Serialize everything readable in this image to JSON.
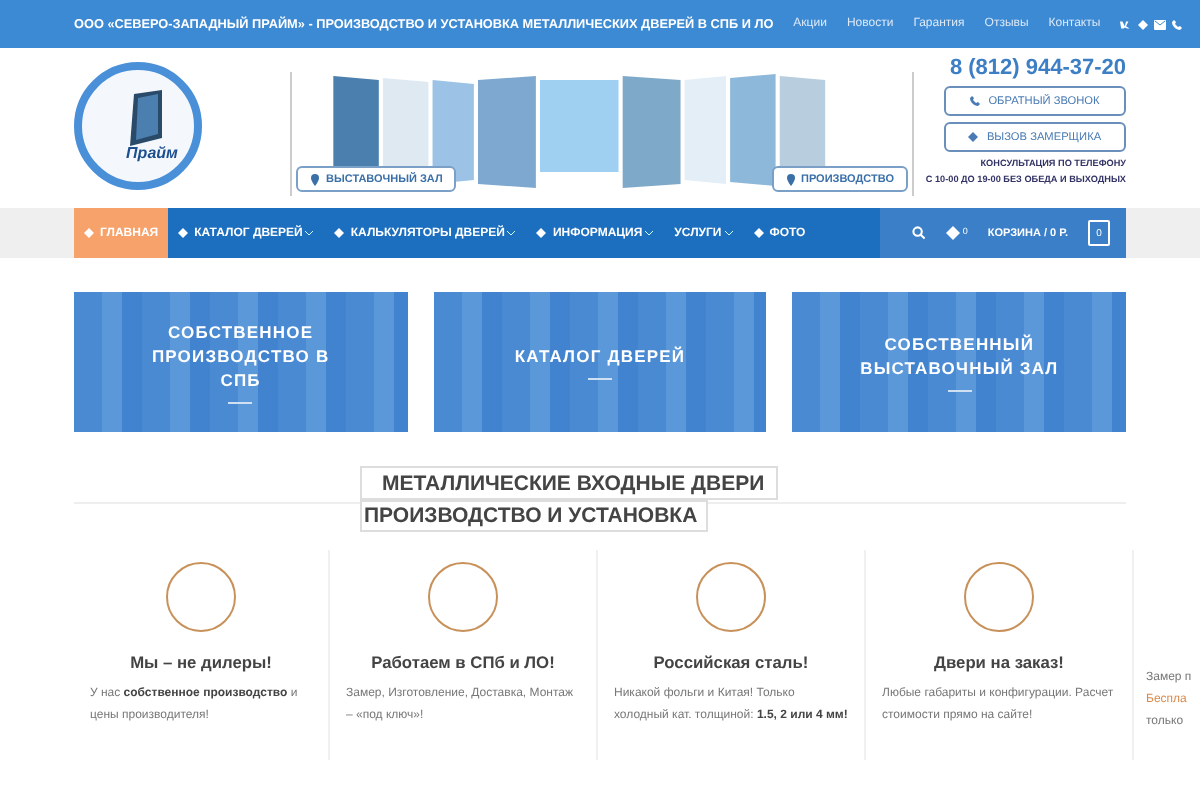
{
  "top_bar": {
    "title": "ООО «СЕВЕРО-ЗАПАДНЫЙ ПРАЙМ» - ПРОИЗВОДСТВО И УСТАНОВКА МЕТАЛЛИЧЕСКИХ ДВЕРЕЙ В СПБ И ЛО",
    "links": [
      "Акции",
      "Новости",
      "Гарантия",
      "Отзывы",
      "Контакты"
    ]
  },
  "header": {
    "logo": {
      "text": "Прайм"
    },
    "banner": {
      "buttons": [
        "ВЫСТАВОЧНЫЙ ЗАЛ",
        "ПРОИЗВОДСТВО"
      ]
    },
    "phone": "8 (812) 944-37-20",
    "buttons": [
      {
        "label": "ОБРАТНЫЙ ЗВОНОК",
        "kind": "phone"
      },
      {
        "label": "ВЫЗОВ ЗАМЕРЩИКА",
        "kind": "diamond"
      }
    ],
    "hours": [
      "КОНСУЛЬТАЦИЯ ПО ТЕЛЕФОНУ",
      "С 10-00 ДО 19-00 БЕЗ ОБЕДА И ВЫХОДНЫХ"
    ]
  },
  "nav": {
    "items": [
      {
        "label": "ГЛАВНАЯ",
        "icon": true,
        "selected": true,
        "dropdown": false
      },
      {
        "label": "КАТАЛОГ ДВЕРЕЙ",
        "icon": true,
        "selected": false,
        "dropdown": true
      },
      {
        "label": "КАЛЬКУЛЯТОРЫ ДВЕРЕЙ",
        "icon": true,
        "selected": false,
        "dropdown": true
      },
      {
        "label": "ИНФОРМАЦИЯ",
        "icon": true,
        "selected": false,
        "dropdown": true
      },
      {
        "label": "УСЛУГИ",
        "icon": false,
        "selected": false,
        "dropdown": true
      },
      {
        "label": "ФОТО",
        "icon": true,
        "selected": false,
        "dropdown": false
      }
    ],
    "wishlist": {
      "count": "0"
    },
    "cart": {
      "label": "КОРЗИНА / 0 Р.",
      "count": "0"
    }
  },
  "cards": [
    "СОБСТВЕННОЕ ПРОИЗВОДСТВО В СПБ",
    "КАТАЛОГ ДВЕРЕЙ",
    "СОБСТВЕННЫЙ ВЫСТАВОЧНЫЙ ЗАЛ"
  ],
  "section_title": [
    "МЕТАЛЛИЧЕСКИЕ ВХОДНЫЕ ДВЕРИ",
    "ПРОИЗВОДСТВО И УСТАНОВКА"
  ],
  "features": [
    {
      "title": "Мы – не дилеры!",
      "text": "У нас **собственное производство** и цены производителя!"
    },
    {
      "title": "Работаем в СПб и ЛО!",
      "text": "Замер, Изготовление, Доставка, Монтаж – «под ключ»!"
    },
    {
      "title": "Российская сталь!",
      "text": "Никакой фольги и Китая! Только холодный кат. толщиной: **1.5, 2 или 4 мм!**"
    },
    {
      "title": "Двери на заказ!",
      "text": "Любые габариты и конфигурации. Расчет стоимости прямо на сайте!"
    }
  ],
  "cut_feature": {
    "lines": [
      {
        "text": "Замер п",
        "kind": "text"
      },
      {
        "text": "Беспла",
        "kind": "link"
      },
      {
        "text": "только",
        "kind": "text"
      }
    ]
  }
}
